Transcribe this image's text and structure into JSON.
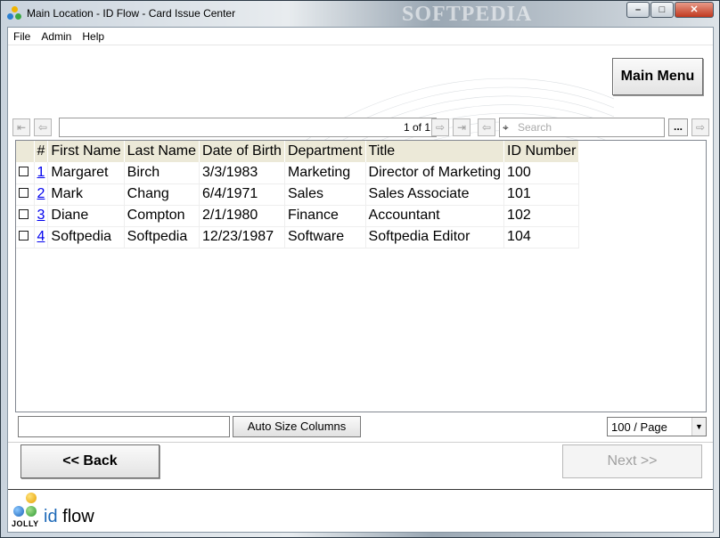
{
  "window": {
    "title": "Main Location - ID Flow - Card Issue Center",
    "watermark": "SOFTPEDIA"
  },
  "window_controls": {
    "minimize": "–",
    "maximize": "□",
    "close": "✕"
  },
  "menu": {
    "items": [
      "File",
      "Admin",
      "Help"
    ]
  },
  "main_menu_button": "Main Menu",
  "pager": {
    "page_text": "1 of 1",
    "search_placeholder": "Search",
    "more_label": "..."
  },
  "table": {
    "columns": [
      "#",
      "First Name",
      "Last Name",
      "Date of Birth",
      "Department",
      "Title",
      "ID Number"
    ],
    "rows": [
      {
        "num": "1",
        "first": "Margaret",
        "last": "Birch",
        "dob": "3/3/1983",
        "dept": "Marketing",
        "title": "Director of Marketing",
        "id": "100"
      },
      {
        "num": "2",
        "first": "Mark",
        "last": "Chang",
        "dob": "6/4/1971",
        "dept": "Sales",
        "title": "Sales Associate",
        "id": "101"
      },
      {
        "num": "3",
        "first": "Diane",
        "last": "Compton",
        "dob": "2/1/1980",
        "dept": "Finance",
        "title": "Accountant",
        "id": "102"
      },
      {
        "num": "4",
        "first": "Softpedia",
        "last": "Softpedia",
        "dob": "12/23/1987",
        "dept": "Software",
        "title": "Softpedia Editor",
        "id": "104"
      }
    ]
  },
  "grid_toolbar": {
    "filter_value": "",
    "auto_size_label": "Auto Size Columns",
    "page_size": "100 / Page"
  },
  "navigation": {
    "back_label": "<< Back",
    "next_label": "Next >>"
  },
  "brand": {
    "id": "id",
    "flow": " flow",
    "logo_text": "JOLLY"
  },
  "colors": {
    "header_bg": "#ece9d8",
    "link": "#0000ee",
    "brand_blue": "#1d69b8"
  }
}
